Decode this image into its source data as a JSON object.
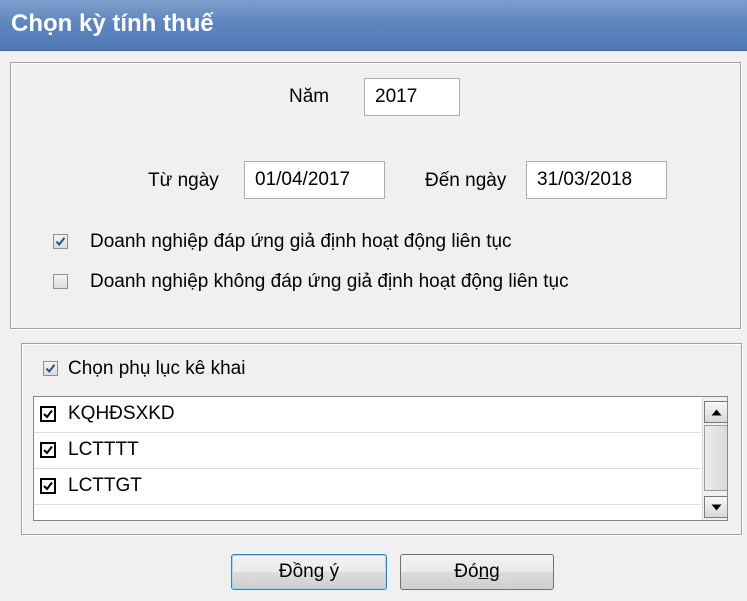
{
  "window": {
    "title": "Chọn kỳ tính thuế"
  },
  "period": {
    "year_label": "Năm",
    "year_value": "2017",
    "from_label": "Từ ngày",
    "from_value": "01/04/2017",
    "to_label": "Đến ngày",
    "to_value": "31/03/2018"
  },
  "options": [
    {
      "label": "Doanh nghiệp đáp ứng giả định hoạt động liên tục",
      "checked": true
    },
    {
      "label": "Doanh nghiệp không đáp ứng giả định hoạt động liên tục",
      "checked": false
    }
  ],
  "appendix": {
    "select_label": "Chọn phụ lục kê khai",
    "select_checked": true,
    "items": [
      {
        "label": "KQHĐSXKD",
        "checked": true
      },
      {
        "label": "LCTTTT",
        "checked": true
      },
      {
        "label": "LCTTGT",
        "checked": true
      }
    ]
  },
  "buttons": {
    "ok_before": "Đồn",
    "ok_accel": "g",
    "ok_after": " ý",
    "close_before": "Đó",
    "close_accel": "ng",
    "close_after": ""
  }
}
